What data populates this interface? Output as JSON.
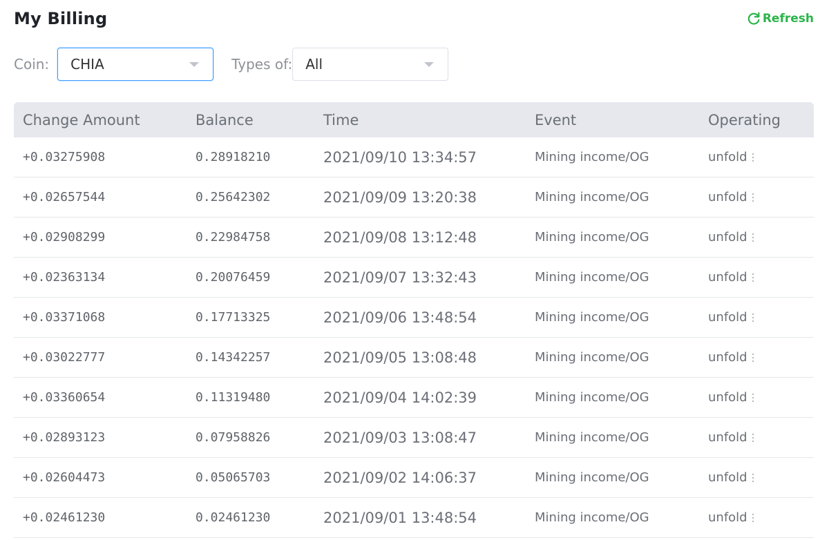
{
  "header": {
    "title": "My Billing",
    "refresh_label": "Refresh",
    "accent_color": "#2bb44a"
  },
  "filters": {
    "coin_label": "Coin:",
    "coin_value": "CHIA",
    "type_label": "Types of:",
    "type_value": "All"
  },
  "table": {
    "columns": [
      "Change Amount",
      "Balance",
      "Time",
      "Event",
      "Operating"
    ],
    "rows": [
      {
        "change": "+0.03275908",
        "balance": "0.28918210",
        "time": "2021/09/10 13:34:57",
        "event": "Mining income/OG",
        "op": "unfold"
      },
      {
        "change": "+0.02657544",
        "balance": "0.25642302",
        "time": "2021/09/09 13:20:38",
        "event": "Mining income/OG",
        "op": "unfold"
      },
      {
        "change": "+0.02908299",
        "balance": "0.22984758",
        "time": "2021/09/08 13:12:48",
        "event": "Mining income/OG",
        "op": "unfold"
      },
      {
        "change": "+0.02363134",
        "balance": "0.20076459",
        "time": "2021/09/07 13:32:43",
        "event": "Mining income/OG",
        "op": "unfold"
      },
      {
        "change": "+0.03371068",
        "balance": "0.17713325",
        "time": "2021/09/06 13:48:54",
        "event": "Mining income/OG",
        "op": "unfold"
      },
      {
        "change": "+0.03022777",
        "balance": "0.14342257",
        "time": "2021/09/05 13:08:48",
        "event": "Mining income/OG",
        "op": "unfold"
      },
      {
        "change": "+0.03360654",
        "balance": "0.11319480",
        "time": "2021/09/04 14:02:39",
        "event": "Mining income/OG",
        "op": "unfold"
      },
      {
        "change": "+0.02893123",
        "balance": "0.07958826",
        "time": "2021/09/03 13:08:47",
        "event": "Mining income/OG",
        "op": "unfold"
      },
      {
        "change": "+0.02604473",
        "balance": "0.05065703",
        "time": "2021/09/02 14:06:37",
        "event": "Mining income/OG",
        "op": "unfold"
      },
      {
        "change": "+0.02461230",
        "balance": "0.02461230",
        "time": "2021/09/01 13:48:54",
        "event": "Mining income/OG",
        "op": "unfold"
      }
    ]
  }
}
